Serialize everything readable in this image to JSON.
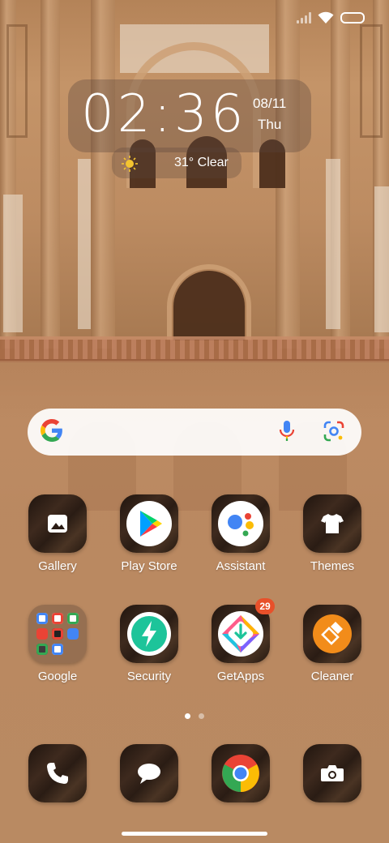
{
  "status_bar": {
    "icons": [
      "signal-icon",
      "wifi-icon",
      "battery-icon"
    ]
  },
  "clock": {
    "time": "02:36",
    "date": "08/11",
    "day": "Thu"
  },
  "weather": {
    "icon": "sun-icon",
    "text": "31° Clear"
  },
  "search": {
    "logo": "google-g-icon",
    "voice": "mic-icon",
    "lens": "lens-icon"
  },
  "apps": {
    "row1": [
      {
        "label": "Gallery",
        "icon": "gallery-icon"
      },
      {
        "label": "Play Store",
        "icon": "play-store-icon"
      },
      {
        "label": "Assistant",
        "icon": "assistant-icon"
      },
      {
        "label": "Themes",
        "icon": "tshirt-icon"
      }
    ],
    "row2": [
      {
        "label": "Google",
        "icon": "folder-icon"
      },
      {
        "label": "Security",
        "icon": "lightning-shield-icon"
      },
      {
        "label": "GetApps",
        "icon": "getapps-icon",
        "badge": "29"
      },
      {
        "label": "Cleaner",
        "icon": "brush-icon"
      }
    ]
  },
  "dock": [
    {
      "icon": "phone-icon"
    },
    {
      "icon": "messages-icon"
    },
    {
      "icon": "chrome-icon"
    },
    {
      "icon": "camera-icon"
    }
  ],
  "page_indicator": {
    "pages": 2,
    "current": 1
  },
  "colors": {
    "badge": "#e8502a",
    "google_blue": "#4285F4",
    "google_red": "#EA4335",
    "google_yellow": "#FBBC05",
    "google_green": "#34A853"
  }
}
